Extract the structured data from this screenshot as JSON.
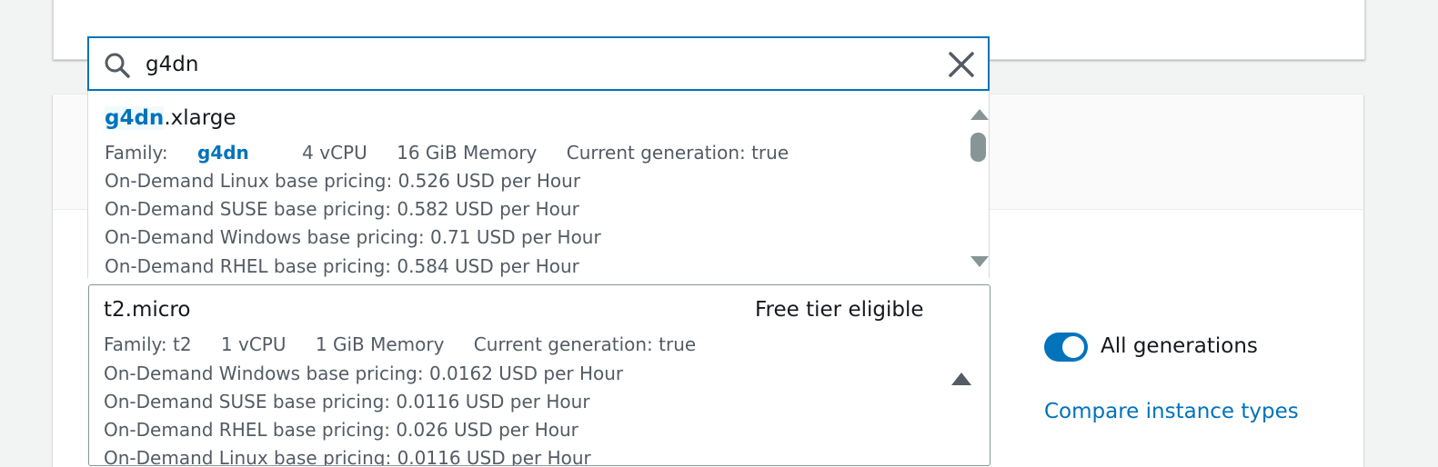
{
  "search": {
    "value": "g4dn",
    "placeholder": ""
  },
  "dropdown": {
    "option": {
      "name_highlight": "g4dn",
      "name_rest": ".xlarge",
      "family_label": "Family:",
      "family_value": "g4dn",
      "vcpu": "4 vCPU",
      "memory": "16 GiB Memory",
      "generation": "Current generation: true",
      "pricing": [
        "On-Demand Linux base pricing: 0.526 USD per Hour",
        "On-Demand SUSE base pricing: 0.582 USD per Hour",
        "On-Demand Windows base pricing: 0.71 USD per Hour",
        "On-Demand RHEL base pricing: 0.584 USD per Hour"
      ]
    }
  },
  "selected": {
    "name": "t2.micro",
    "badge": "Free tier eligible",
    "family": "Family: t2",
    "vcpu": "1 vCPU",
    "memory": "1 GiB Memory",
    "generation": "Current generation: true",
    "pricing": [
      "On-Demand Windows base pricing: 0.0162 USD per Hour",
      "On-Demand SUSE base pricing: 0.0116 USD per Hour",
      "On-Demand RHEL base pricing: 0.026 USD per Hour",
      "On-Demand Linux base pricing: 0.0116 USD per Hour"
    ]
  },
  "toggle": {
    "label": "All generations",
    "checked": true
  },
  "links": {
    "compare": "Compare instance types"
  },
  "colors": {
    "accent": "#0073bb",
    "text": "#16191f",
    "secondary_text": "#545b64"
  },
  "icons": {
    "search": "search-icon",
    "clear": "close-icon",
    "scroll_up": "triangle-up-icon",
    "scroll_down": "triangle-down-icon",
    "collapse": "caret-up-icon"
  }
}
